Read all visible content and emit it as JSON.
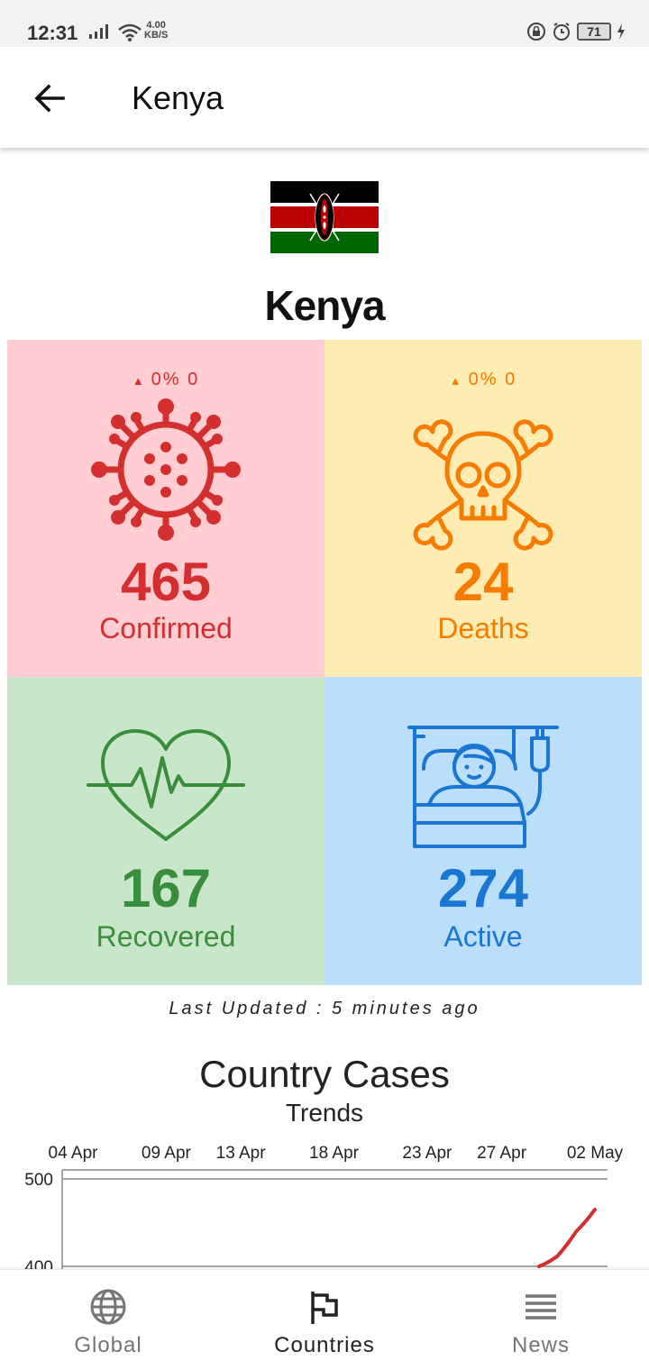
{
  "status_bar": {
    "time": "12:31",
    "net_speed_top": "4.00",
    "net_speed_bottom": "KB/S",
    "battery": "71"
  },
  "app_bar": {
    "title": "Kenya",
    "back_icon": "arrow-left-icon"
  },
  "country": {
    "name": "Kenya",
    "flag_icon": "kenya-flag"
  },
  "stats": {
    "confirmed": {
      "delta_pct": "0%",
      "delta_count": "0",
      "value": "465",
      "label": "Confirmed",
      "icon": "virus-icon",
      "color": "#d32f2f",
      "bg": "#ffcdd2"
    },
    "deaths": {
      "delta_pct": "0%",
      "delta_count": "0",
      "value": "24",
      "label": "Deaths",
      "icon": "skull-crossbones-icon",
      "color": "#f57c00",
      "bg": "#ffecb3"
    },
    "recovered": {
      "value": "167",
      "label": "Recovered",
      "icon": "heartbeat-icon",
      "color": "#388e3c",
      "bg": "#c8e6c9"
    },
    "active": {
      "value": "274",
      "label": "Active",
      "icon": "patient-bed-icon",
      "color": "#1976d2",
      "bg": "#bbdefb"
    }
  },
  "last_updated": "Last Updated : 5 minutes ago",
  "section": {
    "title": "Country Cases",
    "subtitle": "Trends"
  },
  "chart_data": {
    "type": "line",
    "x_ticks": [
      "04 Apr",
      "09 Apr",
      "13 Apr",
      "18 Apr",
      "23 Apr",
      "27 Apr",
      "02 May"
    ],
    "y_ticks": [
      500,
      400
    ],
    "y_visible_range": [
      400,
      500
    ],
    "series": [
      {
        "color": "#d32f2f",
        "x": [
          "29 Apr",
          "30 Apr",
          "01 May",
          "02 May"
        ],
        "y": [
          400,
          412,
          440,
          465
        ]
      }
    ]
  },
  "bottom_nav": {
    "items": [
      {
        "label": "Global",
        "icon": "globe-icon",
        "active": false
      },
      {
        "label": "Countries",
        "icon": "flag-icon",
        "active": true
      },
      {
        "label": "News",
        "icon": "news-icon",
        "active": false
      }
    ]
  }
}
